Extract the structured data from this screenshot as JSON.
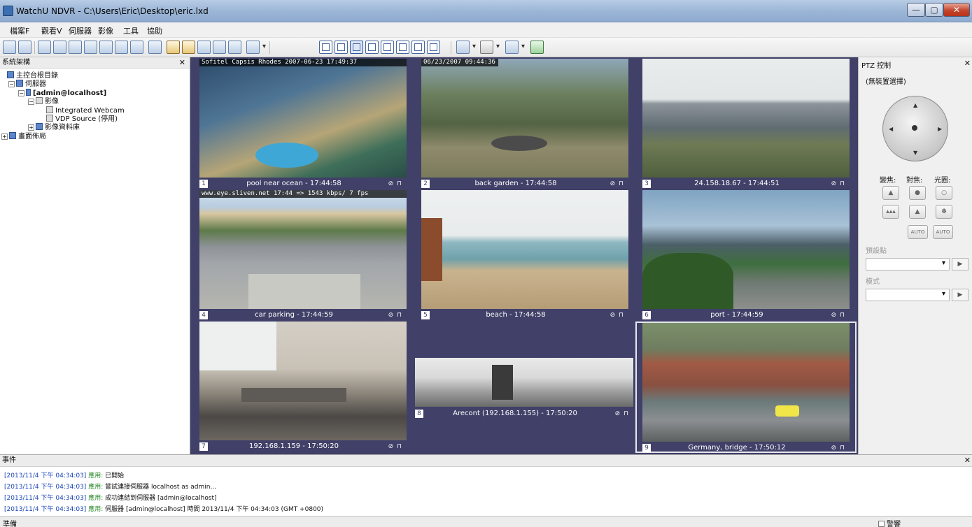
{
  "window": {
    "title": "WatchU NDVR - C:\\Users\\Eric\\Desktop\\eric.lxd",
    "minimize": "—",
    "maximize": "▢",
    "close": "✕"
  },
  "menu": [
    "檔案F",
    "觀看V",
    "伺服器",
    "影像",
    "工具",
    "協助"
  ],
  "left_panel": {
    "title": "系統架構",
    "close": "✕",
    "tree": {
      "root": "主控台根目錄",
      "servers": "伺服器",
      "server": "[admin@localhost]",
      "video": "影像",
      "cam1": "Integrated Webcam",
      "cam2": "VDP Source (停用)",
      "database": "影像資料庫",
      "layout": "畫面佈局"
    }
  },
  "tiles": [
    {
      "num": "1",
      "name": "pool near ocean - 17:44:58",
      "osd": "Sofitel Capsis Rhodes 2007-06-23 17:49:37",
      "icons": "⊘ ⊓"
    },
    {
      "num": "2",
      "name": "back garden - 17:44:58",
      "osd": "06/23/2007 09:44:36",
      "icons": "⊘ ⊓"
    },
    {
      "num": "3",
      "name": "24.158.18.67 - 17:44:51",
      "osd": "",
      "icons": "⊘ ⊓"
    },
    {
      "num": "4",
      "name": "car parking - 17:44:59",
      "osd": "www.eye.sliven.net 17:44 => 1543 kbps/ 7 fps",
      "icons": "⊘ ⊓"
    },
    {
      "num": "5",
      "name": "beach - 17:44:58",
      "osd": "",
      "icons": "⊘ ⊓"
    },
    {
      "num": "6",
      "name": "port - 17:44:59",
      "osd": "",
      "icons": "⊘ ⊓"
    },
    {
      "num": "7",
      "name": "192.168.1.159 - 17:50:20",
      "osd": "",
      "icons": "⊘ ⊓"
    },
    {
      "num": "8",
      "name": "Arecont (192.168.1.155) - 17:50:20",
      "osd": "",
      "icons": "⊘ ⊓"
    },
    {
      "num": "9",
      "name": "Germany, bridge - 17:50:12",
      "osd": "",
      "icons": "⊘ ⊓"
    }
  ],
  "ptz": {
    "title": "PTZ 控制",
    "close": "✕",
    "device": "(無裝置選擇)",
    "zoom_label": "變焦:",
    "focus_label": "對焦:",
    "iris_label": "光圈:",
    "auto": "AUTO",
    "preset_label": "預設點",
    "pattern_label": "模式",
    "play": "▶"
  },
  "events": {
    "title": "事件",
    "close": "✕",
    "rows": [
      {
        "ts": "[2013/11/4 下午 04:34:03]",
        "lv": "應用:",
        "msg": "已開始"
      },
      {
        "ts": "[2013/11/4 下午 04:34:03]",
        "lv": "應用:",
        "msg": "嘗試連接伺服器 localhost as admin..."
      },
      {
        "ts": "[2013/11/4 下午 04:34:03]",
        "lv": "應用:",
        "msg": "成功連結到伺服器 [admin@localhost]"
      },
      {
        "ts": "[2013/11/4 下午 04:34:03]",
        "lv": "應用:",
        "msg": "伺服器 [admin@localhost] 時間 2013/11/4 下午 04:34:03 (GMT +0800)"
      }
    ]
  },
  "status": {
    "left": "準備",
    "right": "警響"
  }
}
